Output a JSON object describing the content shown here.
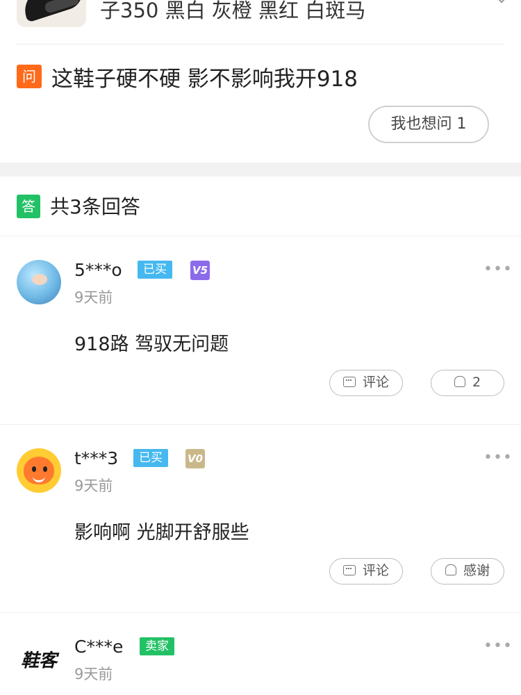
{
  "product": {
    "title": "子350 黑白 灰橙 黑红 白斑马"
  },
  "question": {
    "badge": "问",
    "text": "这鞋子硬不硬 影不影响我开918",
    "ask_button": "我也想问 1"
  },
  "answers_header": {
    "badge": "答",
    "count_text": "共3条回答"
  },
  "answers": [
    {
      "user": "5***o",
      "tag": "已买",
      "vip": "V5",
      "time": "9天前",
      "text": "918路 驾驭无问题",
      "comment_label": "评论",
      "like_label": "2"
    },
    {
      "user": "t***3",
      "tag": "已买",
      "vip": "V0",
      "time": "9天前",
      "text": "影响啊 光脚开舒服些",
      "comment_label": "评论",
      "like_label": "感谢"
    },
    {
      "user": "C***e",
      "tag": "卖家",
      "avatar_text": "鞋客",
      "time": "9天前"
    }
  ],
  "more_symbol": "•••",
  "colors": {
    "question_badge": "#ff6a1a",
    "answer_badge": "#23c166",
    "bought_tag": "#45b8ef",
    "seller_tag": "#23c166",
    "vip5": "#8b6bea",
    "vip0": "#c9b88a"
  }
}
